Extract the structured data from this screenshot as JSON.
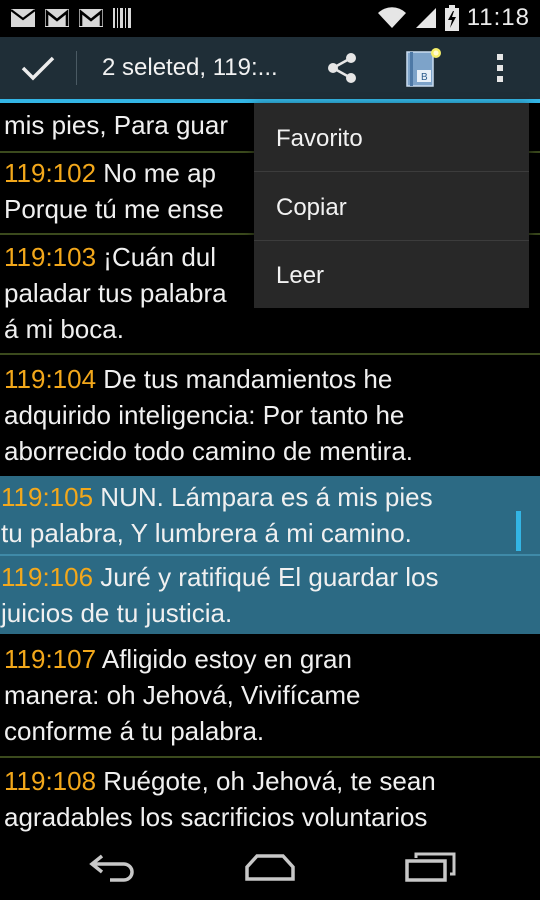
{
  "status_bar": {
    "notifications": [
      "mail-icon",
      "gmail-icon",
      "gmail-icon",
      "barcode-icon"
    ],
    "time": "11:18"
  },
  "action_bar": {
    "title": "2 seleted, 119:...",
    "actions": [
      "done-check-icon",
      "share-icon",
      "book-icon",
      "overflow-menu-icon"
    ]
  },
  "colors": {
    "action_bar_bg": "#1f2e37",
    "accent_blue": "#33b5e5",
    "selected_row_bg": "#2c6a84",
    "verse_number": "#f3a81b",
    "menu_bg": "#282828"
  },
  "verses": [
    {
      "ref": "",
      "lines": [
        "mis pies, Para guar"
      ],
      "selected": false
    },
    {
      "ref": "119:102",
      "lines": [
        " No me ap",
        "Porque tú me ense"
      ],
      "selected": false
    },
    {
      "ref": "119:103",
      "lines": [
        " ¡Cuán dul",
        "paladar tus palabra",
        "á mi boca."
      ],
      "selected": false
    },
    {
      "ref": "119:104",
      "lines": [
        " De tus mandamientos he",
        "adquirido inteligencia: Por tanto he",
        "aborrecido todo camino de mentira."
      ],
      "selected": false
    },
    {
      "ref": "119:105",
      "lines": [
        " NUN. Lámpara es á mis pies",
        "tu palabra, Y lumbrera á mi camino."
      ],
      "selected": true
    },
    {
      "ref": "119:106",
      "lines": [
        " Juré y ratifiqué El guardar los",
        "juicios de tu justicia."
      ],
      "selected": true
    },
    {
      "ref": "119:107",
      "lines": [
        " Afligido estoy en gran",
        "manera: oh Jehová, Vivifícame",
        "conforme á tu palabra."
      ],
      "selected": false
    },
    {
      "ref": "119:108",
      "lines": [
        " Ruégote, oh Jehová, te sean",
        "agradables los sacrificios voluntarios"
      ],
      "selected": false
    }
  ],
  "popup_menu": {
    "items": [
      "Favorito",
      "Copiar",
      "Leer"
    ]
  },
  "nav_bar": {
    "buttons": [
      "back-icon",
      "home-icon",
      "recent-apps-icon"
    ]
  }
}
